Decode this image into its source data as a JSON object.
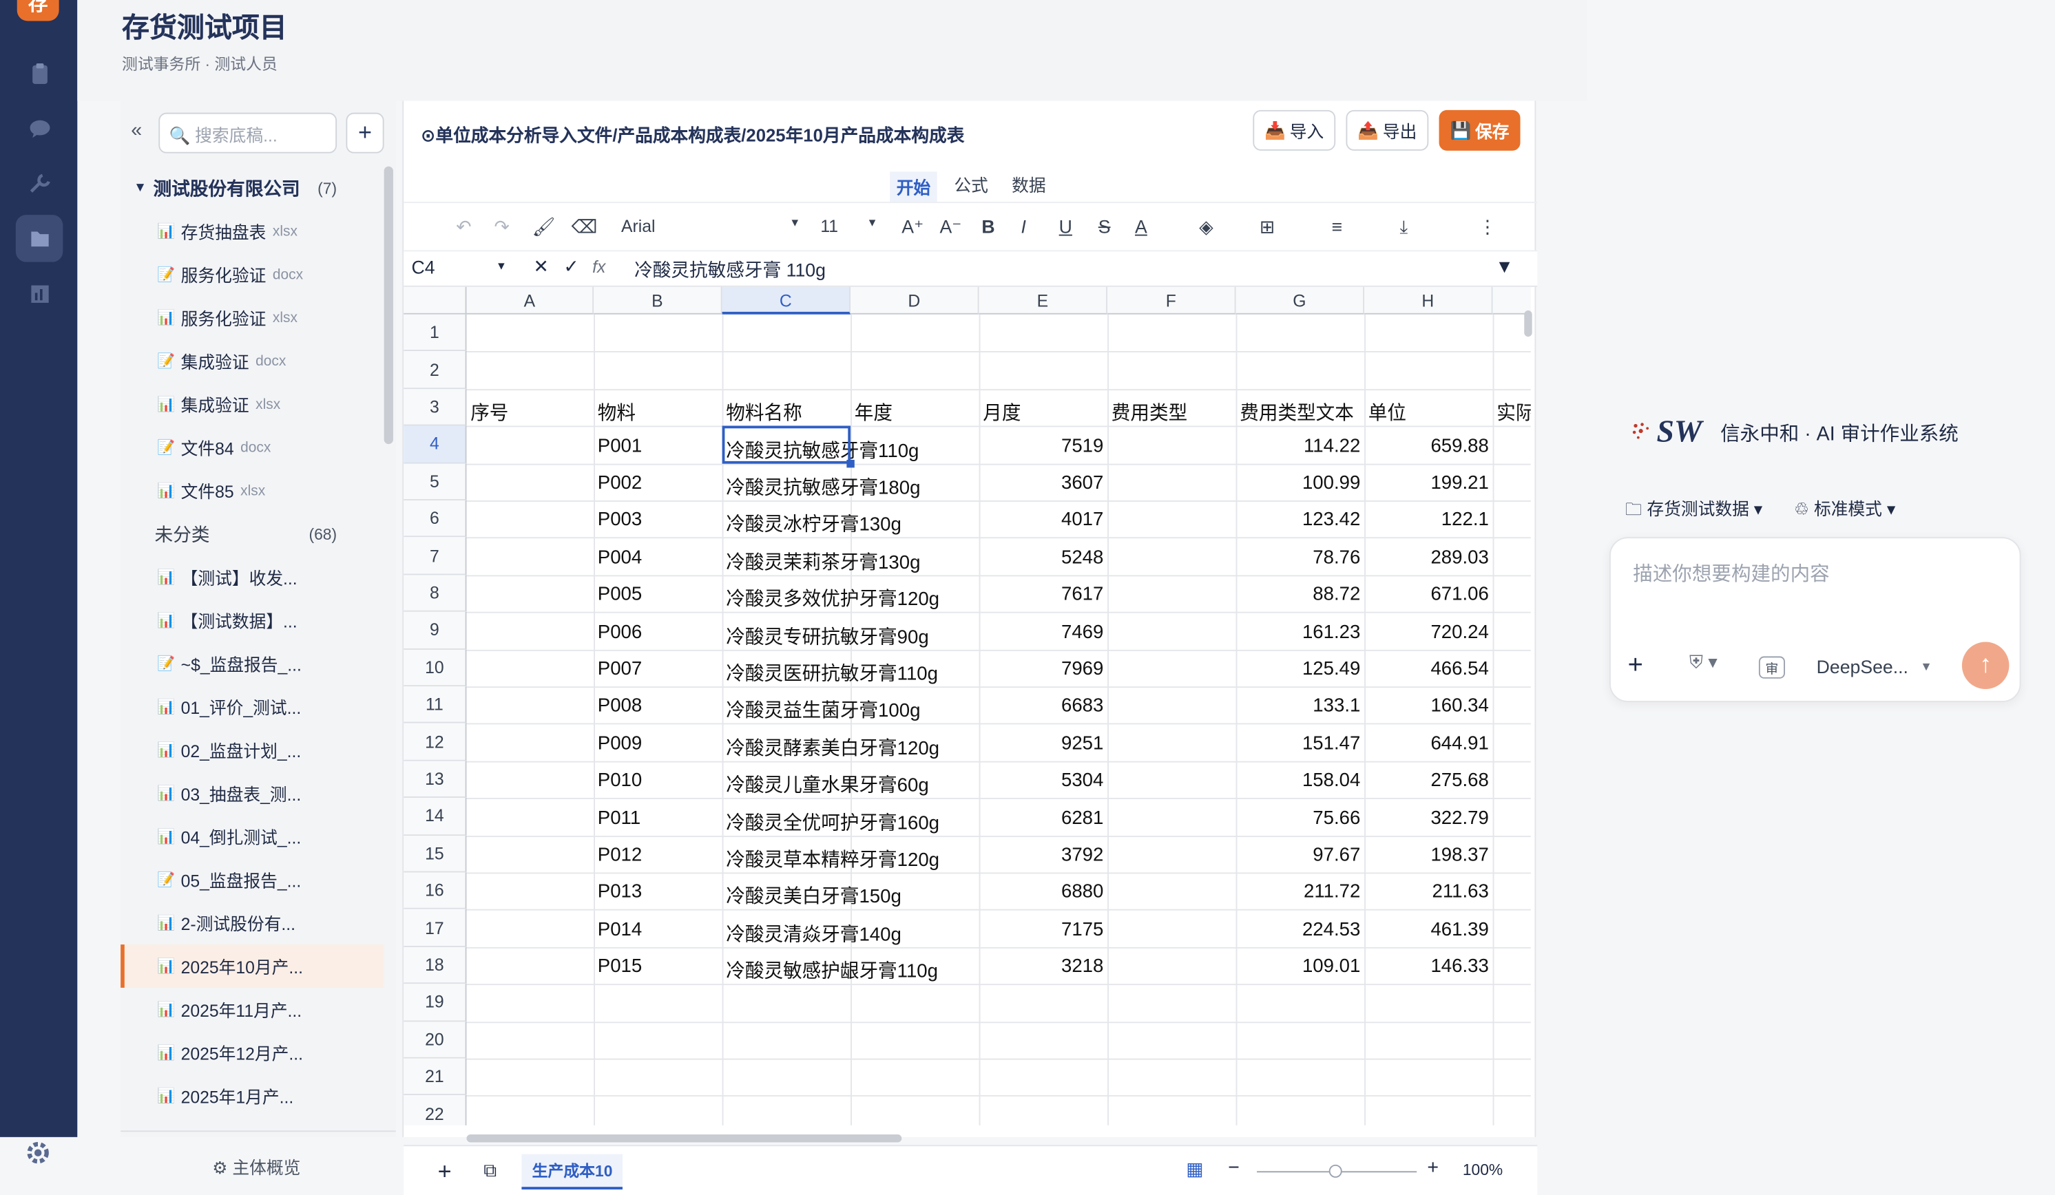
{
  "app": {
    "logo_text": "存",
    "brand_color": "#e8702a",
    "rail_color": "#24335a"
  },
  "rail": [
    "clipboard-icon",
    "chat-icon",
    "wrench-icon",
    "folder-icon",
    "chart-icon",
    "gear-icon"
  ],
  "header": {
    "title": "存货测试项目",
    "subtitle": "测试事务所 · 测试人员"
  },
  "sidebar": {
    "search_placeholder": "🔍 搜索底稿...",
    "collapse": "«",
    "add": "+",
    "group1": {
      "label": "测试股份有限公司",
      "count": "(7)"
    },
    "group1_items": [
      {
        "icon": "📊",
        "name": "存货抽盘表",
        "ext": "xlsx"
      },
      {
        "icon": "📝",
        "name": "服务化验证",
        "ext": "docx"
      },
      {
        "icon": "📊",
        "name": "服务化验证",
        "ext": "xlsx"
      },
      {
        "icon": "📝",
        "name": "集成验证",
        "ext": "docx"
      },
      {
        "icon": "📊",
        "name": "集成验证",
        "ext": "xlsx"
      },
      {
        "icon": "📝",
        "name": "文件84",
        "ext": "docx"
      },
      {
        "icon": "📊",
        "name": "文件85",
        "ext": "xlsx"
      }
    ],
    "group2": {
      "label": "未分类",
      "count": "(68)"
    },
    "group2_items": [
      {
        "icon": "📊",
        "name": "【测试】收发..."
      },
      {
        "icon": "📊",
        "name": "【测试数据】..."
      },
      {
        "icon": "📝",
        "name": "~$_监盘报告_..."
      },
      {
        "icon": "📊",
        "name": "01_评价_测试..."
      },
      {
        "icon": "📊",
        "name": "02_监盘计划_..."
      },
      {
        "icon": "📊",
        "name": "03_抽盘表_测..."
      },
      {
        "icon": "📊",
        "name": "04_倒扎测试_..."
      },
      {
        "icon": "📝",
        "name": "05_监盘报告_..."
      },
      {
        "icon": "📊",
        "name": "2-测试股份有..."
      },
      {
        "icon": "📊",
        "name": "2025年10月产..."
      },
      {
        "icon": "📊",
        "name": "2025年11月产..."
      },
      {
        "icon": "📊",
        "name": "2025年12月产..."
      },
      {
        "icon": "📊",
        "name": "2025年1月产..."
      }
    ],
    "footer": "⚙ 主体概览"
  },
  "doc": {
    "crumb": "⊙单位成本分析导入文件/产品成本构成表/2025年10月产品成本构成表",
    "import": "导入",
    "export": "导出",
    "save": "保存"
  },
  "tabs": {
    "start": "开始",
    "formula": "公式",
    "data": "数据"
  },
  "toolbar": {
    "font": "Arial",
    "size": "11"
  },
  "formula": {
    "ref": "C4",
    "fx": "fx",
    "value": "冷酸灵抗敏感牙膏 110g"
  },
  "columns": [
    "A",
    "B",
    "C",
    "D",
    "E",
    "F",
    "G",
    "H",
    ""
  ],
  "sheet_header": [
    "序号",
    "物料",
    "物料名称",
    "年度",
    "月度",
    "费用类型",
    "费用类型文本",
    "单位",
    "实际"
  ],
  "rows": [
    {
      "code": "P001",
      "name": "冷酸灵抗敏感牙膏110g",
      "month": "7519",
      "text": "114.22",
      "unit": "659.88"
    },
    {
      "code": "P002",
      "name": "冷酸灵抗敏感牙膏180g",
      "month": "3607",
      "text": "100.99",
      "unit": "199.21"
    },
    {
      "code": "P003",
      "name": "冷酸灵冰柠牙膏130g",
      "month": "4017",
      "text": "123.42",
      "unit": "122.1"
    },
    {
      "code": "P004",
      "name": "冷酸灵茉莉茶牙膏130g",
      "month": "5248",
      "text": "78.76",
      "unit": "289.03"
    },
    {
      "code": "P005",
      "name": "冷酸灵多效优护牙膏120g",
      "month": "7617",
      "text": "88.72",
      "unit": "671.06"
    },
    {
      "code": "P006",
      "name": "冷酸灵专研抗敏牙膏90g",
      "month": "7469",
      "text": "161.23",
      "unit": "720.24"
    },
    {
      "code": "P007",
      "name": "冷酸灵医研抗敏牙膏110g",
      "month": "7969",
      "text": "125.49",
      "unit": "466.54"
    },
    {
      "code": "P008",
      "name": "冷酸灵益生菌牙膏100g",
      "month": "6683",
      "text": "133.1",
      "unit": "160.34"
    },
    {
      "code": "P009",
      "name": "冷酸灵酵素美白牙膏120g",
      "month": "9251",
      "text": "151.47",
      "unit": "644.91"
    },
    {
      "code": "P010",
      "name": "冷酸灵儿童水果牙膏60g",
      "month": "5304",
      "text": "158.04",
      "unit": "275.68"
    },
    {
      "code": "P011",
      "name": "冷酸灵全优呵护牙膏160g",
      "month": "6281",
      "text": "75.66",
      "unit": "322.79"
    },
    {
      "code": "P012",
      "name": "冷酸灵草本精粹牙膏120g",
      "month": "3792",
      "text": "97.67",
      "unit": "198.37"
    },
    {
      "code": "P013",
      "name": "冷酸灵美白牙膏150g",
      "month": "6880",
      "text": "211.72",
      "unit": "211.63"
    },
    {
      "code": "P014",
      "name": "冷酸灵清焱牙膏140g",
      "month": "7175",
      "text": "224.53",
      "unit": "461.39"
    },
    {
      "code": "P015",
      "name": "冷酸灵敏感护龈牙膏110g",
      "month": "3218",
      "text": "109.01",
      "unit": "146.33"
    }
  ],
  "row_numbers": [
    "1",
    "2",
    "3",
    "4",
    "5",
    "6",
    "7",
    "8",
    "9",
    "10",
    "11",
    "12",
    "13",
    "14",
    "15",
    "16",
    "17",
    "18",
    "19",
    "20",
    "21",
    "22"
  ],
  "bottom": {
    "add": "+",
    "sheet": "生产成本10",
    "zoom": "100%",
    "minus": "−",
    "plus": "+"
  },
  "ai": {
    "brand": "SW",
    "title": "信永中和 · AI 审计作业系统",
    "db": "存货测试数据",
    "mode": "标准模式",
    "placeholder": "描述你想要构建的内容",
    "model": "DeepSee...",
    "audit": "审"
  }
}
